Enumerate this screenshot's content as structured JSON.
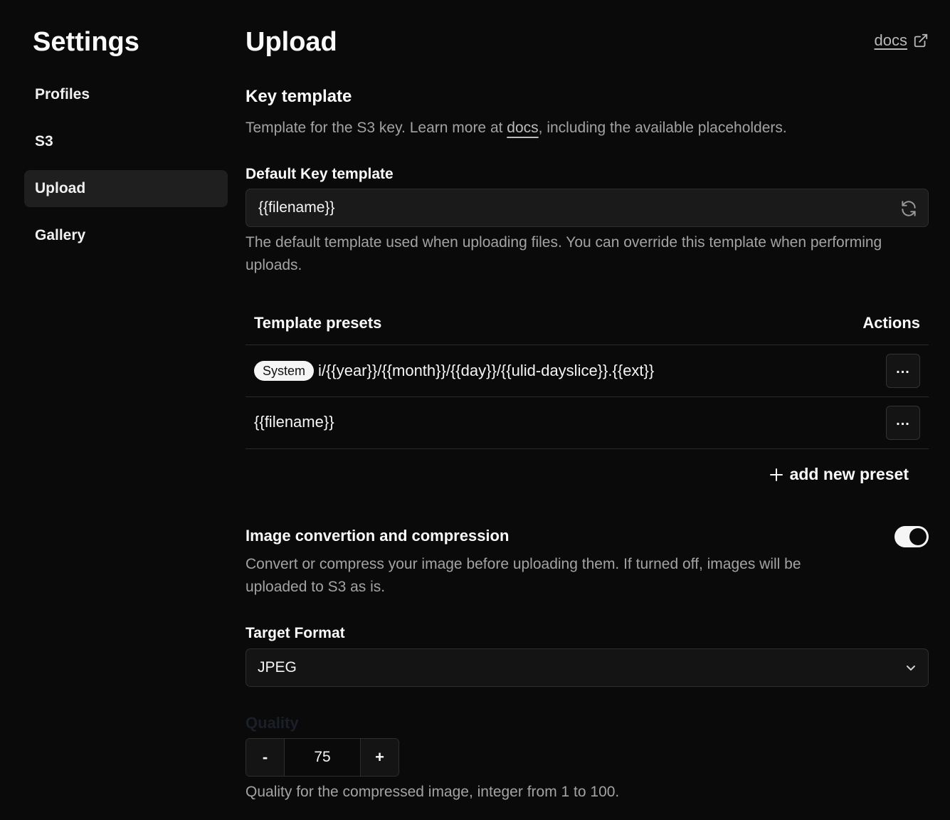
{
  "sidebar": {
    "title": "Settings",
    "items": [
      {
        "label": "Profiles",
        "active": false
      },
      {
        "label": "S3",
        "active": false
      },
      {
        "label": "Upload",
        "active": true
      },
      {
        "label": "Gallery",
        "active": false
      }
    ]
  },
  "header": {
    "title": "Upload",
    "docs_label": "docs"
  },
  "key_template": {
    "heading": "Key template",
    "desc_before": "Template for the S3 key. Learn more at ",
    "desc_link": "docs",
    "desc_after": ", including the available placeholders.",
    "default_label": "Default Key template",
    "default_value": "{{filename}}",
    "default_help": "The default template used when uploading files. You can override this template when performing uploads."
  },
  "presets": {
    "col_name": "Template presets",
    "col_actions": "Actions",
    "rows": [
      {
        "badge": "System",
        "template": "i/{{year}}/{{month}}/{{day}}/{{ulid-dayslice}}.{{ext}}",
        "action": "..."
      },
      {
        "badge": "",
        "template": "{{filename}}",
        "action": "..."
      }
    ],
    "add_label": "add new preset"
  },
  "compression": {
    "heading": "Image convertion and compression",
    "enabled": true,
    "desc": "Convert or compress your image before uploading them. If turned off, images will be uploaded to S3 as is.",
    "format_label": "Target Format",
    "format_value": "JPEG",
    "quality_label": "Quality",
    "quality_minus": "-",
    "quality_value": "75",
    "quality_plus": "+",
    "quality_help": "Quality for the compressed image, integer from 1 to 100."
  },
  "colors": {
    "background": "#0a0a0a",
    "active_nav": "#1f1f1f",
    "muted_text": "#a3a3a3"
  }
}
